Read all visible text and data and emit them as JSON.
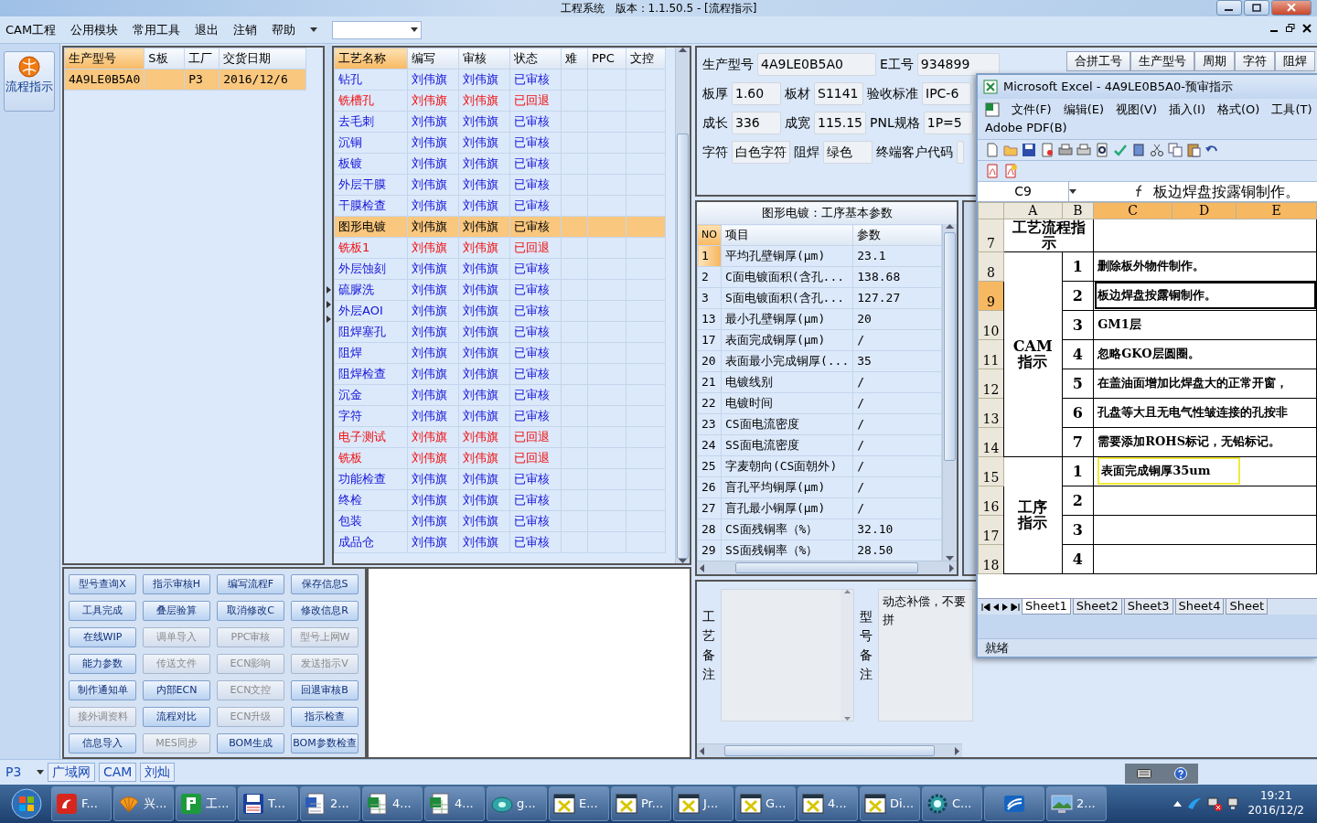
{
  "window": {
    "title": "工程系统　版本：1.1.50.5 - [流程指示]"
  },
  "menu": [
    "CAM工程",
    "公用模块",
    "常用工具",
    "退出",
    "注销",
    "帮助"
  ],
  "sidebar": {
    "button": "流程指示"
  },
  "orders": {
    "columns": [
      "生产型号",
      "S板",
      "工厂",
      "交货日期"
    ],
    "rows": [
      {
        "model": "4A9LE0B5A0",
        "factory": "P3",
        "date": "2016/12/6",
        "selected": true
      }
    ]
  },
  "process": {
    "columns": [
      "工艺名称",
      "编写",
      "审核",
      "状态",
      "难",
      "PPC",
      "文控"
    ],
    "rows": [
      {
        "name": "钻孔",
        "writer": "刘伟旗",
        "reviewer": "刘伟旗",
        "status": "已审核",
        "returned": false,
        "selected": false
      },
      {
        "name": "铣槽孔",
        "writer": "刘伟旗",
        "reviewer": "刘伟旗",
        "status": "已回退",
        "returned": true,
        "selected": false
      },
      {
        "name": "去毛刺",
        "writer": "刘伟旗",
        "reviewer": "刘伟旗",
        "status": "已审核",
        "returned": false,
        "selected": false
      },
      {
        "name": "沉铜",
        "writer": "刘伟旗",
        "reviewer": "刘伟旗",
        "status": "已审核",
        "returned": false,
        "selected": false
      },
      {
        "name": "板镀",
        "writer": "刘伟旗",
        "reviewer": "刘伟旗",
        "status": "已审核",
        "returned": false,
        "selected": false
      },
      {
        "name": "外层干膜",
        "writer": "刘伟旗",
        "reviewer": "刘伟旗",
        "status": "已审核",
        "returned": false,
        "selected": false
      },
      {
        "name": "干膜检查",
        "writer": "刘伟旗",
        "reviewer": "刘伟旗",
        "status": "已审核",
        "returned": false,
        "selected": false
      },
      {
        "name": "图形电镀",
        "writer": "刘伟旗",
        "reviewer": "刘伟旗",
        "status": "已审核",
        "returned": false,
        "selected": true
      },
      {
        "name": "铣板1",
        "writer": "刘伟旗",
        "reviewer": "刘伟旗",
        "status": "已回退",
        "returned": true,
        "selected": false
      },
      {
        "name": "外层蚀刻",
        "writer": "刘伟旗",
        "reviewer": "刘伟旗",
        "status": "已审核",
        "returned": false,
        "selected": false
      },
      {
        "name": "硫脲洗",
        "writer": "刘伟旗",
        "reviewer": "刘伟旗",
        "status": "已审核",
        "returned": false,
        "selected": false
      },
      {
        "name": "外层AOI",
        "writer": "刘伟旗",
        "reviewer": "刘伟旗",
        "status": "已审核",
        "returned": false,
        "selected": false
      },
      {
        "name": "阻焊塞孔",
        "writer": "刘伟旗",
        "reviewer": "刘伟旗",
        "status": "已审核",
        "returned": false,
        "selected": false
      },
      {
        "name": "阻焊",
        "writer": "刘伟旗",
        "reviewer": "刘伟旗",
        "status": "已审核",
        "returned": false,
        "selected": false
      },
      {
        "name": "阻焊检查",
        "writer": "刘伟旗",
        "reviewer": "刘伟旗",
        "status": "已审核",
        "returned": false,
        "selected": false
      },
      {
        "name": "沉金",
        "writer": "刘伟旗",
        "reviewer": "刘伟旗",
        "status": "已审核",
        "returned": false,
        "selected": false
      },
      {
        "name": "字符",
        "writer": "刘伟旗",
        "reviewer": "刘伟旗",
        "status": "已审核",
        "returned": false,
        "selected": false
      },
      {
        "name": "电子测试",
        "writer": "刘伟旗",
        "reviewer": "刘伟旗",
        "status": "已回退",
        "returned": true,
        "selected": false
      },
      {
        "name": "铣板",
        "writer": "刘伟旗",
        "reviewer": "刘伟旗",
        "status": "已回退",
        "returned": true,
        "selected": false
      },
      {
        "name": "功能检查",
        "writer": "刘伟旗",
        "reviewer": "刘伟旗",
        "status": "已审核",
        "returned": false,
        "selected": false
      },
      {
        "name": "终检",
        "writer": "刘伟旗",
        "reviewer": "刘伟旗",
        "status": "已审核",
        "returned": false,
        "selected": false
      },
      {
        "name": "包装",
        "writer": "刘伟旗",
        "reviewer": "刘伟旗",
        "status": "已审核",
        "returned": false,
        "selected": false
      },
      {
        "name": "成品仓",
        "writer": "刘伟旗",
        "reviewer": "刘伟旗",
        "status": "已审核",
        "returned": false,
        "selected": false
      }
    ]
  },
  "actions": [
    {
      "label": "型号查询X",
      "disabled": false
    },
    {
      "label": "指示审核H",
      "disabled": false
    },
    {
      "label": "编写流程F",
      "disabled": false
    },
    {
      "label": "保存信息S",
      "disabled": false
    },
    {
      "label": "工具完成",
      "disabled": false
    },
    {
      "label": "叠层验算",
      "disabled": false
    },
    {
      "label": "取消修改C",
      "disabled": false
    },
    {
      "label": "修改信息R",
      "disabled": false
    },
    {
      "label": "在线WIP",
      "disabled": false
    },
    {
      "label": "调单导入",
      "disabled": true
    },
    {
      "label": "PPC审核",
      "disabled": true
    },
    {
      "label": "型号上网W",
      "disabled": true
    },
    {
      "label": "能力参数",
      "disabled": false
    },
    {
      "label": "传送文件",
      "disabled": true
    },
    {
      "label": "ECN影响",
      "disabled": true
    },
    {
      "label": "发送指示V",
      "disabled": true
    },
    {
      "label": "制作通知单",
      "disabled": false
    },
    {
      "label": "内部ECN",
      "disabled": false
    },
    {
      "label": "ECN文控",
      "disabled": true
    },
    {
      "label": "回退审核B",
      "disabled": false
    },
    {
      "label": "接外调资料",
      "disabled": true
    },
    {
      "label": "流程对比",
      "disabled": false
    },
    {
      "label": "ECN升级",
      "disabled": true
    },
    {
      "label": "指示检查",
      "disabled": false
    },
    {
      "label": "信息导入",
      "disabled": false
    },
    {
      "label": "MES同步",
      "disabled": true
    },
    {
      "label": "BOM生成",
      "disabled": false
    },
    {
      "label": "BOM参数检查",
      "disabled": false
    }
  ],
  "info": [
    [
      {
        "label": "生产型号",
        "value": "4A9LE0B5A0"
      },
      {
        "label": "E工号",
        "value": "934899"
      }
    ],
    [
      {
        "label": "板厚",
        "value": "1.60"
      },
      {
        "label": "板材",
        "value": "S1141"
      },
      {
        "label": "验收标准",
        "value": "IPC-6"
      }
    ],
    [
      {
        "label": "成长",
        "value": "336"
      },
      {
        "label": "成宽",
        "value": "115.15"
      },
      {
        "label": "PNL规格",
        "value": "1P=5"
      }
    ],
    [
      {
        "label": "字符",
        "value": "白色字符"
      },
      {
        "label": "阻焊",
        "value": "绿色"
      },
      {
        "label": "终端客户代码"
      }
    ]
  ],
  "merge_columns": [
    "合拼工号",
    "生产型号",
    "周期",
    "字符",
    "阻焊"
  ],
  "params": {
    "title": "图形电镀：工序基本参数",
    "columns": [
      "NO",
      "项目",
      "参数"
    ],
    "rows": [
      {
        "no": "1",
        "item": "平均孔壁铜厚(μm)",
        "value": "23.1",
        "selected": true
      },
      {
        "no": "2",
        "item": "C面电镀面积(含孔...",
        "value": "138.68",
        "selected": false
      },
      {
        "no": "3",
        "item": "S面电镀面积(含孔...",
        "value": "127.27",
        "selected": false
      },
      {
        "no": "13",
        "item": "最小孔壁铜厚(μm)",
        "value": "20",
        "selected": false
      },
      {
        "no": "17",
        "item": "表面完成铜厚(μm)",
        "value": "/",
        "selected": false
      },
      {
        "no": "20",
        "item": "表面最小完成铜厚(...",
        "value": "35",
        "selected": false
      },
      {
        "no": "21",
        "item": "电镀线别",
        "value": "/",
        "selected": false
      },
      {
        "no": "22",
        "item": "电镀时间",
        "value": "/",
        "selected": false
      },
      {
        "no": "23",
        "item": "CS面电流密度",
        "value": "/",
        "selected": false
      },
      {
        "no": "24",
        "item": "SS面电流密度",
        "value": "/",
        "selected": false
      },
      {
        "no": "25",
        "item": "字麦朝向(CS面朝外)",
        "value": "/",
        "selected": false
      },
      {
        "no": "26",
        "item": "盲孔平均铜厚(μm)",
        "value": "/",
        "selected": false
      },
      {
        "no": "27",
        "item": "盲孔最小铜厚(μm)",
        "value": "/",
        "selected": false
      },
      {
        "no": "28",
        "item": "CS面残铜率（%）",
        "value": "32.10",
        "selected": false
      },
      {
        "no": "29",
        "item": "SS面残铜率（%）",
        "value": "28.50",
        "selected": false
      }
    ]
  },
  "notes": [
    {
      "label": "工艺备注"
    },
    {
      "label": "型号备注",
      "value": "动态补偿，不要拼"
    }
  ],
  "status_bar": {
    "factory": "P3",
    "items": [
      "广域网",
      "CAM",
      "刘灿"
    ]
  },
  "excel": {
    "title": "Microsoft Excel - 4A9LE0B5A0-预审指示",
    "menu": [
      "文件(F)",
      "编辑(E)",
      "视图(V)",
      "插入(I)",
      "格式(O)",
      "工具(T)",
      "Adobe PDF(B)"
    ],
    "name_box": "C9",
    "formula": "板边焊盘按露铜制作。",
    "columns": [
      {
        "label": "A",
        "selected": false
      },
      {
        "label": "B",
        "selected": false
      },
      {
        "label": "C",
        "selected": true
      },
      {
        "label": "D",
        "selected": true
      },
      {
        "label": "E",
        "selected": true
      }
    ],
    "groups": [
      {
        "label": "工艺流程指示",
        "rows": [
          {
            "row": "7",
            "selected": false
          }
        ]
      },
      {
        "label": "CAM指示",
        "rows": [
          {
            "row": "8",
            "no": "1",
            "text": "删除板外物件制作。",
            "selected": false,
            "highlighted": false
          },
          {
            "row": "9",
            "no": "2",
            "text": "板边焊盘按露铜制作。",
            "selected": true,
            "highlighted": false
          },
          {
            "row": "10",
            "no": "3",
            "text": "GM1层",
            "selected": false,
            "highlighted": false
          },
          {
            "row": "11",
            "no": "4",
            "text": "忽略GKO层圆圈。",
            "selected": false,
            "highlighted": false
          },
          {
            "row": "12",
            "no": "5",
            "text": "在盖油面增加比焊盘大的正常开窗，",
            "selected": false,
            "highlighted": false
          },
          {
            "row": "13",
            "no": "6",
            "text": "孔盘等大且无电气性皱连接的孔按非",
            "selected": false,
            "highlighted": false
          },
          {
            "row": "14",
            "no": "7",
            "text": "需要添加ROHS标记，无铅标记。",
            "selected": false,
            "highlighted": false
          }
        ]
      },
      {
        "label": "工序指示",
        "rows": [
          {
            "row": "15",
            "no": "1",
            "text": "表面完成铜厚35um",
            "selected": false,
            "highlighted": true
          },
          {
            "row": "16",
            "no": "2",
            "selected": false,
            "highlighted": false
          },
          {
            "row": "17",
            "no": "3",
            "selected": false,
            "highlighted": false
          },
          {
            "row": "18",
            "no": "4",
            "selected": false,
            "highlighted": false
          }
        ]
      }
    ],
    "sheets": [
      {
        "label": "Sheet1",
        "selected": true
      },
      {
        "label": "Sheet2",
        "selected": false
      },
      {
        "label": "Sheet3",
        "selected": false
      },
      {
        "label": "Sheet4",
        "selected": false
      },
      {
        "label": "Sheet",
        "selected": false
      }
    ],
    "status": "就绪"
  },
  "taskbar": {
    "items": [
      {
        "kind": "fire",
        "label": "F..."
      },
      {
        "kind": "shell",
        "label": "兴..."
      },
      {
        "kind": "pcb",
        "label": "工..."
      },
      {
        "kind": "disk",
        "label": "T..."
      },
      {
        "kind": "word",
        "label": "2..."
      },
      {
        "kind": "excel",
        "label": "4..."
      },
      {
        "kind": "excel",
        "label": "4..."
      },
      {
        "kind": "disc",
        "label": "g..."
      },
      {
        "kind": "xwin",
        "label": "E..."
      },
      {
        "kind": "xwin",
        "label": "Pr..."
      },
      {
        "kind": "xwin",
        "label": "J..."
      },
      {
        "kind": "xwin",
        "label": "G..."
      },
      {
        "kind": "xwin",
        "label": "4..."
      },
      {
        "kind": "xwin",
        "label": "Di..."
      },
      {
        "kind": "gear",
        "label": "C..."
      },
      {
        "kind": "fiber"
      },
      {
        "kind": "screen",
        "label": "2..."
      }
    ],
    "time": "19:21",
    "date": "2016/12/2"
  }
}
